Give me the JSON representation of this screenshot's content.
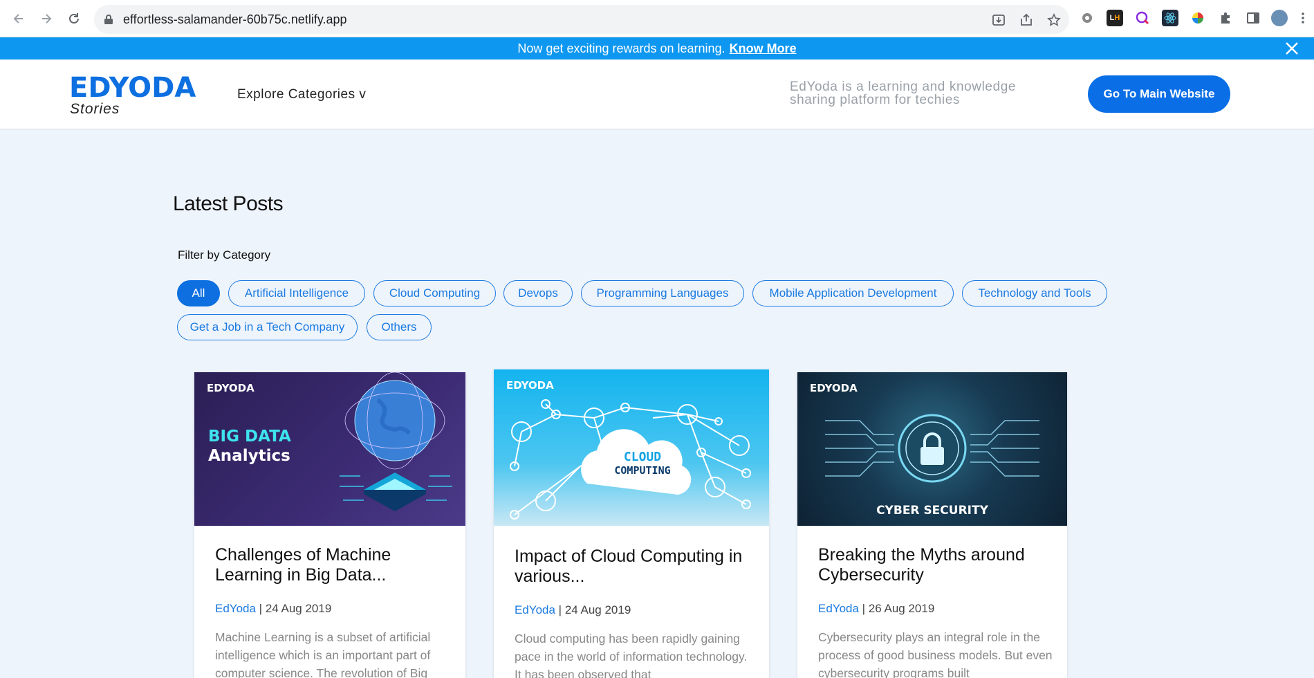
{
  "browser": {
    "url": "effortless-salamander-60b75c.netlify.app",
    "extensions": [
      "gear-extension",
      "lighthouse-extension",
      "query-extension",
      "react-devtools",
      "color-extension",
      "puzzle-extensions"
    ]
  },
  "announcement": {
    "text": "Now get exciting rewards on learning.",
    "link": "Know More"
  },
  "header": {
    "logo": "EDYODA",
    "logo_sub": "Stories",
    "explore": "Explore Categories v",
    "tagline": "EdYoda is a learning and knowledge sharing platform for techies",
    "main_button": "Go To Main Website"
  },
  "main": {
    "heading": "Latest Posts",
    "filter_label": "Filter by Category",
    "categories": [
      "All",
      "Artificial Intelligence",
      "Cloud Computing",
      "Devops",
      "Programming Languages",
      "Mobile Application Development",
      "Technology and Tools",
      "Get a Job in a Tech Company",
      "Others"
    ],
    "active_category": "All"
  },
  "posts": [
    {
      "image_brand": "EDYODA",
      "image_title_1": "BIG DATA",
      "image_title_2": "Analytics",
      "title": "Challenges of Machine Learning in Big Data...",
      "author": "EdYoda",
      "date": "24 Aug 2019",
      "excerpt": "Machine Learning is a subset of artificial intelligence which is an important part of computer science. The revolution of Big"
    },
    {
      "image_brand": "EDYODA",
      "image_title_1": "CLOUD",
      "image_title_2": "COMPUTING",
      "title": "Impact of Cloud Computing in various...",
      "author": "EdYoda",
      "date": "24 Aug 2019",
      "excerpt": "Cloud computing has been rapidly gaining pace in the world of information technology. It has been observed that"
    },
    {
      "image_brand": "EDYODA",
      "image_title_1": "CYBER SECURITY",
      "title": "Breaking the Myths around Cybersecurity",
      "author": "EdYoda",
      "date": "26 Aug 2019",
      "excerpt": "Cybersecurity plays an integral role in the process of good business models. But even cybersecurity programs built"
    }
  ],
  "colors": {
    "accent": "#0d6fe0",
    "announce_bg": "#0d97f0",
    "page_bg": "#eef4fc"
  }
}
